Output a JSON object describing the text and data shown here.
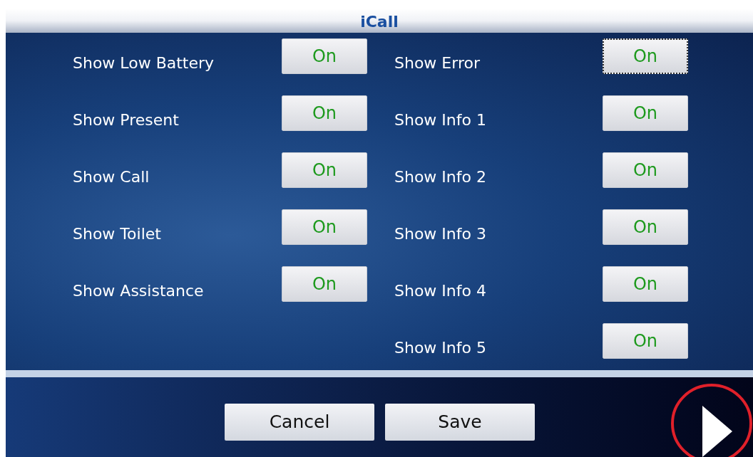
{
  "window": {
    "title": "iCall"
  },
  "columns": [
    [
      {
        "label": "Show Low Battery",
        "value": "On",
        "focused": false
      },
      {
        "label": "Show Present",
        "value": "On",
        "focused": false
      },
      {
        "label": "Show Call",
        "value": "On",
        "focused": false
      },
      {
        "label": "Show Toilet",
        "value": "On",
        "focused": false
      },
      {
        "label": "Show Assistance",
        "value": "On",
        "focused": false
      }
    ],
    [
      {
        "label": "Show Error",
        "value": "On",
        "focused": true
      },
      {
        "label": "Show Info 1",
        "value": "On",
        "focused": false
      },
      {
        "label": "Show Info 2",
        "value": "On",
        "focused": false
      },
      {
        "label": "Show Info 3",
        "value": "On",
        "focused": false
      },
      {
        "label": "Show Info 4",
        "value": "On",
        "focused": false
      },
      {
        "label": "Show Info 5",
        "value": "On",
        "focused": false
      }
    ]
  ],
  "buttons": [
    "Cancel",
    "Save"
  ]
}
